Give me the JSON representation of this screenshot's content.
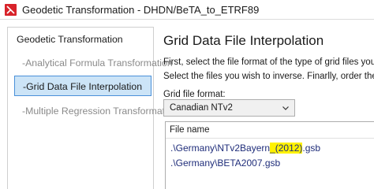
{
  "window": {
    "title": "Geodetic Transformation - DHDN/BeTA_to_ETRF89",
    "icon": "app-icon",
    "icon_color": "#d8232a"
  },
  "nav": {
    "items": [
      {
        "label": "Geodetic Transformation"
      },
      {
        "label": "-Analytical Formula Transformation"
      },
      {
        "label": "-Grid Data File Interpolation"
      },
      {
        "label": "-Multiple Regression Transformation"
      }
    ],
    "selected_color": "#cce4f7",
    "selected_border": "#4a90d9"
  },
  "main": {
    "title": "Grid Data File Interpolation",
    "instruction_line1": "First, select the file format of the type of grid files you want t",
    "instruction_line2": "Select the files you wish to inverse. Finarlly, order them using",
    "grid_format_label": "Grid file format:",
    "grid_format_value": "Canadian NTv2",
    "file_list": {
      "column_header": "File name",
      "files": [
        {
          "pre": ".\\Germany\\NTv2Bayern",
          "highlight": "_(2012)",
          "post": ".gsb"
        },
        {
          "pre": ".\\Germany\\BETA2007.gsb",
          "highlight": "",
          "post": ""
        }
      ],
      "highlight_color": "#fff200",
      "file_text_color": "#1f2d7a"
    }
  }
}
